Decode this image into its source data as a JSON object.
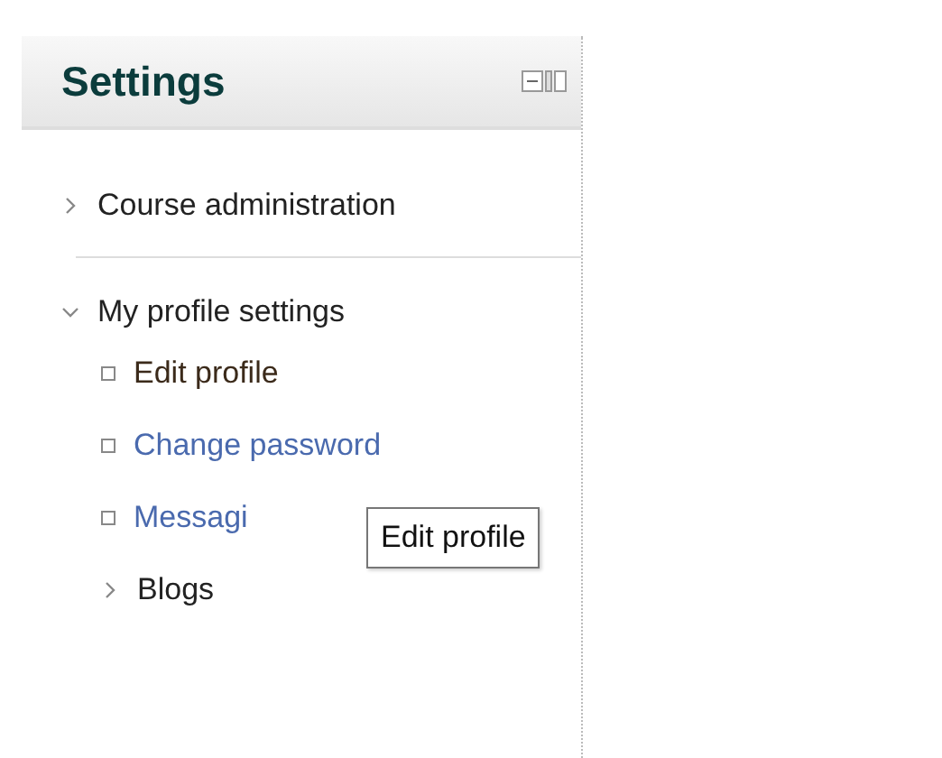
{
  "block": {
    "title": "Settings",
    "items": [
      {
        "kind": "branch",
        "label": "Course administration",
        "expanded": false
      },
      {
        "kind": "branch",
        "label": "My profile settings",
        "expanded": true,
        "children": [
          {
            "kind": "leaf",
            "label": "Edit profile",
            "active": true
          },
          {
            "kind": "leaf",
            "label": "Change password",
            "active": false
          },
          {
            "kind": "leaf",
            "label": "Messagi",
            "active": false
          },
          {
            "kind": "branch",
            "label": "Blogs",
            "expanded": false
          }
        ]
      }
    ]
  },
  "tooltip": {
    "text": "Edit profile"
  }
}
